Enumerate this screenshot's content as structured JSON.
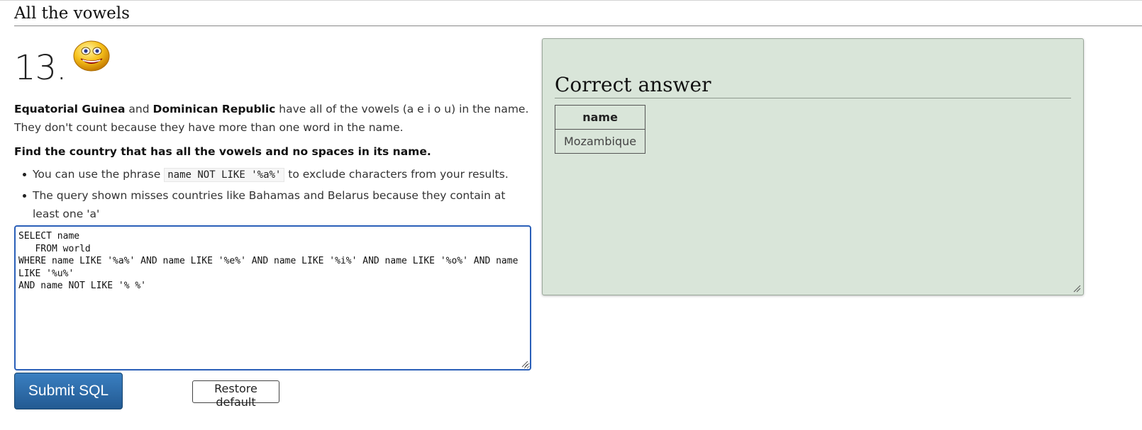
{
  "section": {
    "title": "All the vowels"
  },
  "question": {
    "number": "13."
  },
  "intro": {
    "country_1": "Equatorial Guinea",
    "and_text": " and ",
    "country_2": "Dominican Republic",
    "rest": " have all of the vowels (a e i o u) in the name. They don't count because they have more than one word in the name."
  },
  "task": "Find the country that has all the vowels and no spaces in its name.",
  "hints": [
    {
      "before": "You can use the phrase ",
      "code": "name NOT LIKE '%a%'",
      "after": " to exclude characters from your results."
    },
    {
      "text": "The query shown misses countries like Bahamas and Belarus because they contain at least one 'a'"
    }
  ],
  "editor": {
    "sql": "SELECT name\n   FROM world\nWHERE name LIKE '%a%' AND name LIKE '%e%' AND name LIKE '%i%' AND name LIKE '%o%' AND name LIKE '%u%'\nAND name NOT LIKE '% %'"
  },
  "buttons": {
    "submit": "Submit SQL",
    "restore": "Restore default"
  },
  "answer": {
    "title": "Correct answer",
    "columns": [
      "name"
    ],
    "rows": [
      [
        "Mozambique"
      ]
    ]
  },
  "colors": {
    "submit_button": "#2a6aa6",
    "answer_panel": "#d9e5d9",
    "editor_border": "#2a5fb8"
  },
  "icons": {
    "question": "smiley-face-icon"
  }
}
